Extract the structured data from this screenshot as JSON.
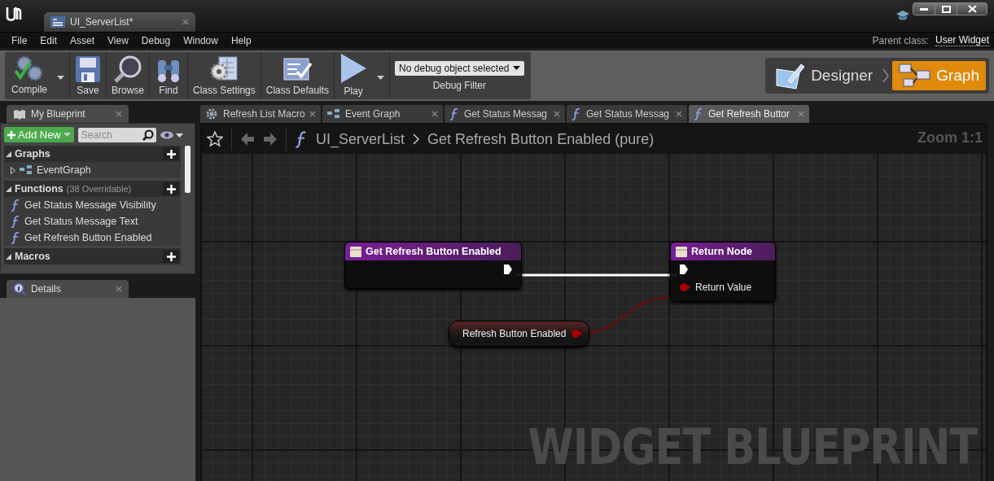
{
  "title_bar": {
    "document_tab": {
      "title": "UI_ServerList*"
    }
  },
  "menu": [
    "File",
    "Edit",
    "Asset",
    "View",
    "Debug",
    "Window",
    "Help"
  ],
  "parent_class": {
    "label": "Parent class:",
    "value": "User Widget"
  },
  "toolbar": [
    {
      "kind": "compile",
      "label": "Compile",
      "dropdown": true
    },
    {
      "kind": "save",
      "label": "Save",
      "dropdown": false
    },
    {
      "kind": "browse",
      "label": "Browse",
      "dropdown": false
    },
    {
      "kind": "find",
      "label": "Find",
      "dropdown": false
    },
    {
      "kind": "class_settings",
      "label": "Class Settings",
      "dropdown": false
    },
    {
      "kind": "class_defaults",
      "label": "Class Defaults",
      "dropdown": false
    },
    {
      "kind": "play",
      "label": "Play",
      "dropdown": true
    }
  ],
  "debug_filter": {
    "value": "No debug object selected",
    "label": "Debug Filter"
  },
  "mode_switch": [
    {
      "kind": "designer",
      "label": "Designer",
      "selected": false
    },
    {
      "kind": "graph",
      "label": "Graph",
      "selected": true
    }
  ],
  "my_blueprint": {
    "tab": "My Blueprint",
    "add_new": "Add New",
    "search_placeholder": "Search",
    "sections": [
      {
        "title": "Graphs",
        "items": [
          {
            "kind": "graph",
            "label": "EventGraph"
          }
        ]
      },
      {
        "title": "Functions",
        "note": "(38 Overridable)",
        "items": [
          {
            "kind": "function",
            "label": "Get Status Message Visibility"
          },
          {
            "kind": "function",
            "label": "Get Status Message Text"
          },
          {
            "kind": "function",
            "label": "Get Refresh Button Enabled"
          }
        ]
      },
      {
        "title": "Macros"
      }
    ]
  },
  "details": {
    "tab": "Details"
  },
  "editor_tabs": [
    {
      "kind": "macro",
      "label": "Refresh List Macro",
      "selected": false
    },
    {
      "kind": "graph",
      "label": "Event Graph",
      "selected": false
    },
    {
      "kind": "function",
      "label": "Get Status Messag",
      "selected": false
    },
    {
      "kind": "function",
      "label": "Get Status Messag",
      "selected": false
    },
    {
      "kind": "function",
      "label": "Get Refresh Buttor",
      "selected": true
    }
  ],
  "breadcrumb": {
    "root": "UI_ServerList",
    "current": "Get Refresh Button Enabled (pure)"
  },
  "zoom": "Zoom 1:1",
  "nodes": [
    {
      "kind": "entry",
      "title": "Get Refresh Button Enabled"
    },
    {
      "kind": "return",
      "title": "Return Node",
      "pin": "Return Value"
    },
    {
      "kind": "variable",
      "label": "Refresh Button Enabled"
    }
  ],
  "watermark": "WIDGET BLUEPRINT"
}
